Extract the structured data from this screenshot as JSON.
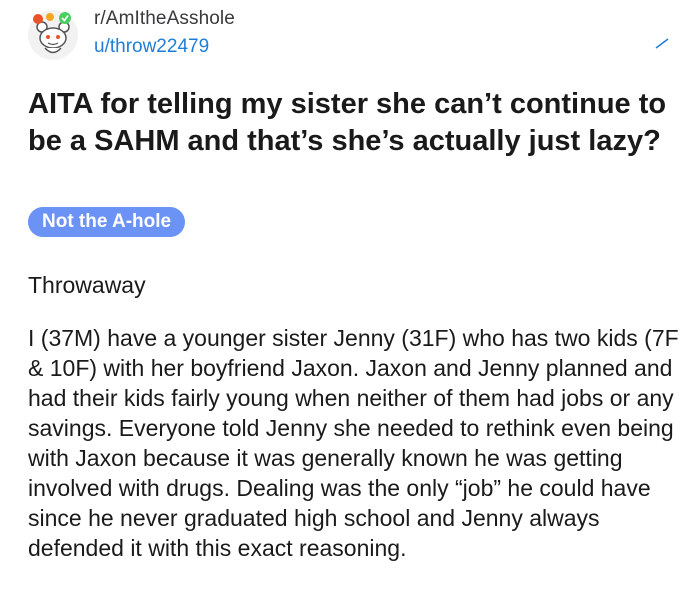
{
  "post": {
    "subreddit": "r/AmItheAsshole",
    "username": "u/throw22479",
    "title": "AITA for telling my sister she can’t continue to be a SAHM and that’s she’s actually just lazy?",
    "flair": "Not the A-hole",
    "body_intro": "Throwaway",
    "body_text": "I (37M) have a younger sister Jenny (31F) who has two kids (7F & 10F) with her boyfriend Jaxon. Jaxon and Jenny planned and had their kids fairly young when neither of them had jobs or any savings. Everyone told Jenny she needed to rethink even being with Jaxon because it was generally known he was getting involved with drugs. Dealing was the only “job” he could have since he never graduated high school and Jenny always defended it with this exact reasoning."
  },
  "colors": {
    "flair_bg": "#6b93f5",
    "username": "#1f7ed6",
    "text": "#1a1a1b"
  },
  "icons": {
    "avatar": "snoo-avatar-icon",
    "edit": "edit-mark-icon"
  }
}
